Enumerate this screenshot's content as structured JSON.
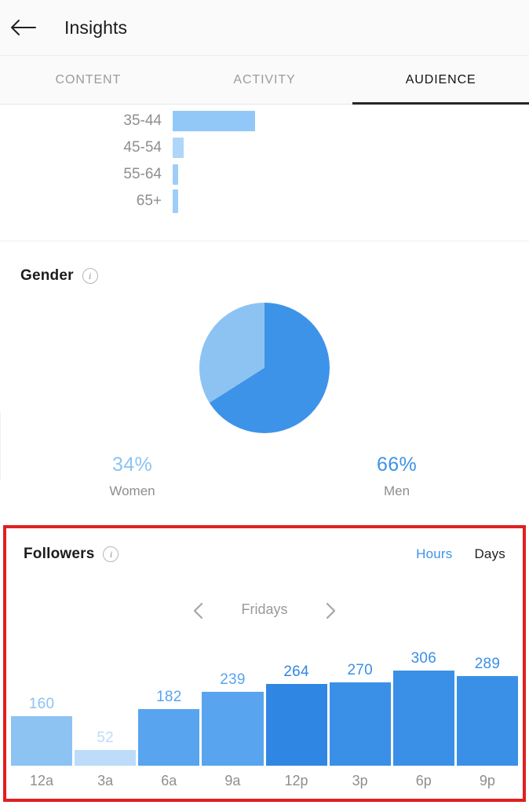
{
  "header": {
    "title": "Insights",
    "back_icon": "arrow-left-icon"
  },
  "tabs": [
    {
      "label": "CONTENT",
      "active": false
    },
    {
      "label": "ACTIVITY",
      "active": false
    },
    {
      "label": "AUDIENCE",
      "active": true
    }
  ],
  "age_section": {
    "rows": [
      {
        "label": "35-44",
        "value": 105
      },
      {
        "label": "45-54",
        "value": 14
      },
      {
        "label": "55-64",
        "value": 7
      },
      {
        "label": "65+",
        "value": 7
      }
    ]
  },
  "gender_section": {
    "title": "Gender",
    "info_icon": "info-icon",
    "legend": [
      {
        "pct": "34%",
        "name": "Women"
      },
      {
        "pct": "66%",
        "name": "Men"
      }
    ]
  },
  "followers_section": {
    "title": "Followers",
    "info_icon": "info-icon",
    "toggle_hours": "Hours",
    "toggle_days": "Days",
    "prev_icon": "chevron-left-icon",
    "next_icon": "chevron-right-icon",
    "day_label": "Fridays"
  },
  "colors": {
    "accent_blue": "#3d93e8",
    "light_blue": "#8cc3f2",
    "annotation_red": "#e02020",
    "muted_text": "#8e8e8e"
  },
  "chart_data": [
    {
      "type": "bar",
      "orientation": "horizontal",
      "title": "Age Range",
      "categories": [
        "35-44",
        "45-54",
        "55-64",
        "65+"
      ],
      "values": [
        105,
        14,
        7,
        7
      ],
      "note": "chart is clipped at top of viewport; values are relative bar lengths in px",
      "xlabel": "",
      "ylabel": "",
      "grid": false
    },
    {
      "type": "pie",
      "title": "Gender",
      "categories": [
        "Men",
        "Women"
      ],
      "values": [
        66,
        34
      ],
      "labels": [
        "66%",
        "34%"
      ],
      "legend_position": "bottom",
      "colors": [
        "#3d93e8",
        "#8cc3f2"
      ],
      "start_angle_deg": 0
    },
    {
      "type": "bar",
      "orientation": "vertical",
      "title": "Followers",
      "subtitle": "Fridays",
      "categories": [
        "12a",
        "3a",
        "6a",
        "9a",
        "12p",
        "3p",
        "6p",
        "9p"
      ],
      "values": [
        160,
        52,
        182,
        239,
        264,
        270,
        306,
        289
      ],
      "bar_colors": [
        "#8cc3f2",
        "#bcdcfa",
        "#58a4ef",
        "#58a4ef",
        "#3087e3",
        "#3a90e6",
        "#3a90e6",
        "#3a90e6"
      ],
      "label_colors": [
        "#8cc3f2",
        "#bcdcfa",
        "#58a4ef",
        "#58a4ef",
        "#3087e3",
        "#3a90e6",
        "#3a90e6",
        "#3a90e6"
      ],
      "ylim": [
        0,
        340
      ],
      "xlabel": "",
      "ylabel": "",
      "grid": false
    }
  ]
}
